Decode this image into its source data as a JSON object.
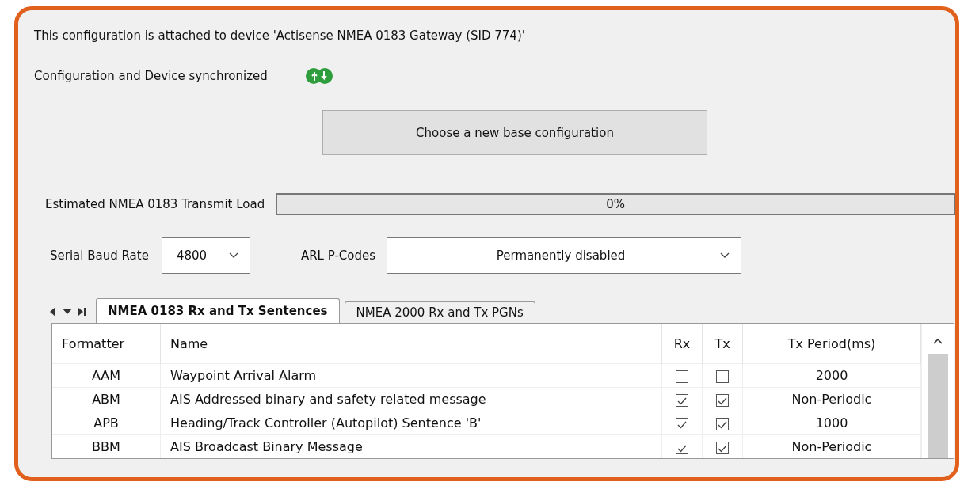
{
  "info_line": "This configuration is attached to device 'Actisense NMEA 0183 Gateway (SID 774)'",
  "sync": {
    "label": "Configuration and Device synchronized",
    "synchronized": true
  },
  "base_button": "Choose a new base configuration",
  "transmit_load": {
    "label": "Estimated NMEA 0183 Transmit Load",
    "level": 0,
    "reading": "0%"
  },
  "baud_rate": {
    "label": "Serial Baud Rate",
    "value": "4800"
  },
  "arl_pcodes": {
    "label": "ARL P-Codes",
    "value": "Permanently disabled"
  },
  "tabs": [
    {
      "label": "NMEA 0183 Rx and Tx Sentences",
      "selected": true
    },
    {
      "label": "NMEA 2000 Rx and Tx PGNs",
      "selected": false
    }
  ],
  "table": {
    "columns": [
      "Formatter",
      "Name",
      "Rx",
      "Tx",
      "Tx Period(ms)"
    ],
    "rows": [
      {
        "formatter": "AAM",
        "name": "Waypoint Arrival Alarm",
        "rx": false,
        "tx": false,
        "period": "2000"
      },
      {
        "formatter": "ABM",
        "name": "AIS Addressed binary and safety related message",
        "rx": true,
        "tx": true,
        "period": "Non-Periodic"
      },
      {
        "formatter": "APB",
        "name": "Heading/Track Controller (Autopilot) Sentence 'B'",
        "rx": true,
        "tx": true,
        "period": "1000"
      },
      {
        "formatter": "BBM",
        "name": "AIS Broadcast Binary Message",
        "rx": true,
        "tx": true,
        "period": "Non-Periodic"
      }
    ]
  }
}
